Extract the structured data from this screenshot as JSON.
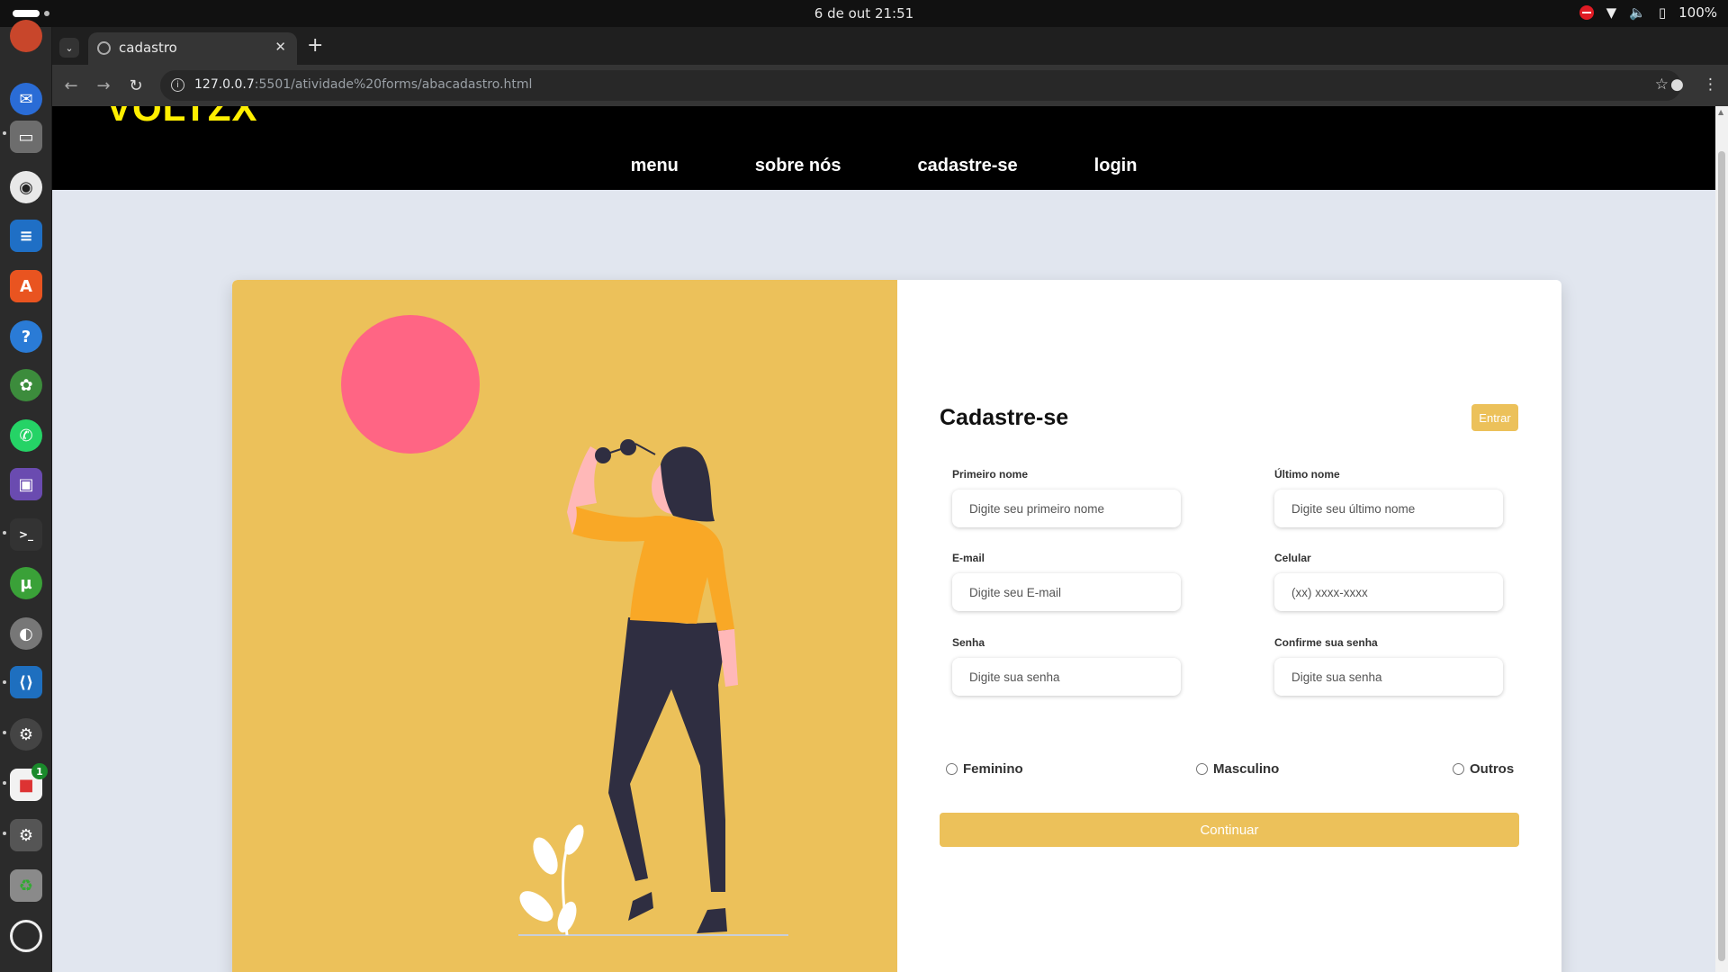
{
  "system": {
    "clock": "6 de out  21:51",
    "battery": "100%"
  },
  "browser": {
    "tab_title": "cadastro",
    "url_host": "127.0.0.7",
    "url_rest": ":5501/atividade%20forms/abacadastro.html"
  },
  "dock": {
    "badge_count": "1"
  },
  "site": {
    "logo": "VOLTZX",
    "nav": [
      "menu",
      "sobre nós",
      "cadastre-se",
      "login"
    ]
  },
  "form": {
    "title": "Cadastre-se",
    "login_button": "Entrar",
    "fields": [
      {
        "label": "Primeiro nome",
        "placeholder": "Digite seu primeiro nome"
      },
      {
        "label": "Último nome",
        "placeholder": "Digite seu último nome"
      },
      {
        "label": "E-mail",
        "placeholder": "Digite seu E-mail"
      },
      {
        "label": "Celular",
        "placeholder": "(xx) xxxx-xxxx"
      },
      {
        "label": "Senha",
        "placeholder": "Digite sua senha"
      },
      {
        "label": "Confirme sua senha",
        "placeholder": "Digite sua senha"
      }
    ],
    "genders": [
      "Feminino",
      "Masculino",
      "Outros"
    ],
    "continue_button": "Continuar"
  },
  "colors": {
    "accent": "#ecc15a",
    "logo": "#ffef00",
    "sun": "#ff6584",
    "page_bg": "#e1e6ef"
  }
}
